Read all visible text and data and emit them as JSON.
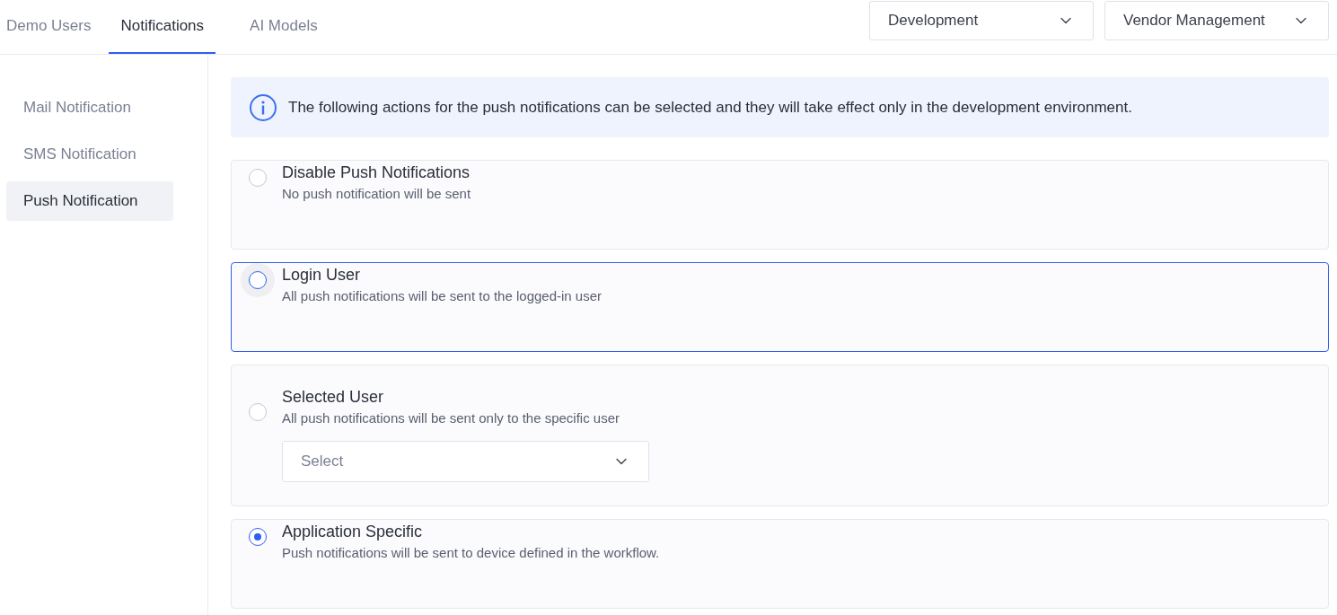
{
  "tabs": [
    {
      "label": "Demo Users",
      "selected": false
    },
    {
      "label": "Notifications",
      "selected": true
    },
    {
      "label": "AI Models",
      "selected": false
    }
  ],
  "header_dropdowns": [
    {
      "value": "Development"
    },
    {
      "value": "Vendor Management"
    }
  ],
  "sidebar": {
    "items": [
      {
        "label": "Mail Notification",
        "selected": false
      },
      {
        "label": "SMS Notification",
        "selected": false
      },
      {
        "label": "Push Notification",
        "selected": true
      }
    ]
  },
  "info_banner": {
    "text": "The following actions for the push notifications can be selected and they will take effect only in the development environment."
  },
  "options": [
    {
      "title": "Disable Push Notifications",
      "description": "No push notification will be sent",
      "selected": false,
      "focused": false
    },
    {
      "title": "Login User",
      "description": "All push notifications will be sent to the logged-in user",
      "selected": false,
      "focused": true
    },
    {
      "title": "Selected User",
      "description": "All push notifications will be sent only to the specific user",
      "selected": false,
      "focused": false,
      "select": {
        "placeholder": "Select"
      }
    },
    {
      "title": "Application Specific",
      "description": "Push notifications will be sent to device defined in the workflow.",
      "selected": true,
      "focused": false
    }
  ]
}
